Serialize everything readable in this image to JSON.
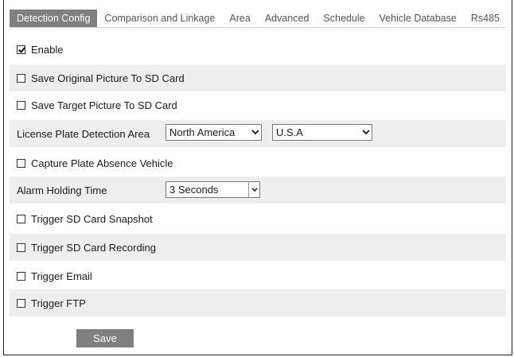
{
  "tabs": [
    {
      "label": "Detection Config",
      "active": true
    },
    {
      "label": "Comparison and Linkage"
    },
    {
      "label": "Area"
    },
    {
      "label": "Advanced"
    },
    {
      "label": "Schedule"
    },
    {
      "label": "Vehicle Database"
    },
    {
      "label": "Rs485"
    }
  ],
  "form": {
    "enable": {
      "label": "Enable",
      "checked": true
    },
    "save_original": {
      "label": "Save Original Picture To SD Card",
      "checked": false
    },
    "save_target": {
      "label": "Save Target Picture To SD Card",
      "checked": false
    },
    "lpd_area": {
      "label": "License Plate Detection Area",
      "region_value": "North America",
      "country_value": "U.S.A"
    },
    "capture_absence": {
      "label": "Capture Plate Absence Vehicle",
      "checked": false
    },
    "alarm_holding": {
      "label": "Alarm Holding Time",
      "value": "3 Seconds"
    },
    "trigger_snapshot": {
      "label": "Trigger SD Card Snapshot",
      "checked": false
    },
    "trigger_recording": {
      "label": "Trigger SD Card Recording",
      "checked": false
    },
    "trigger_email": {
      "label": "Trigger Email",
      "checked": false
    },
    "trigger_ftp": {
      "label": "Trigger FTP",
      "checked": false
    }
  },
  "save_label": "Save",
  "icons": {
    "dropdown": "chevron-down-icon",
    "checkbox": "checkbox-icon"
  },
  "colors": {
    "active_tab": "#808080",
    "row_shade": "#eeeeee",
    "button": "#808080"
  }
}
